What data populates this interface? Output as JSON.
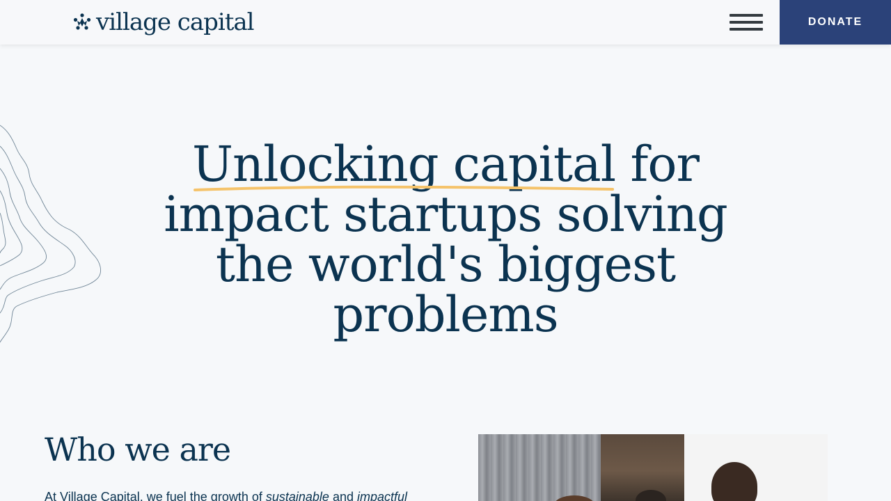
{
  "header": {
    "logo_text": "village capital",
    "menu_icon": "hamburger-menu-icon",
    "donate_label": "DONATE"
  },
  "hero": {
    "highlight": "Unlocking capital",
    "rest_line1": " for",
    "line2": "impact startups solving",
    "line3": "the world's biggest",
    "line4": "problems"
  },
  "who": {
    "title": "Who we are",
    "text_start": "At Village Capital, we fuel the growth of ",
    "em1": "sustainable",
    "text_mid": " and ",
    "em2": "impactful"
  },
  "colors": {
    "brand_navy": "#0b3350",
    "donate_bg": "#2b4279",
    "underline": "#f5c36a",
    "background": "#f6f8fa"
  }
}
